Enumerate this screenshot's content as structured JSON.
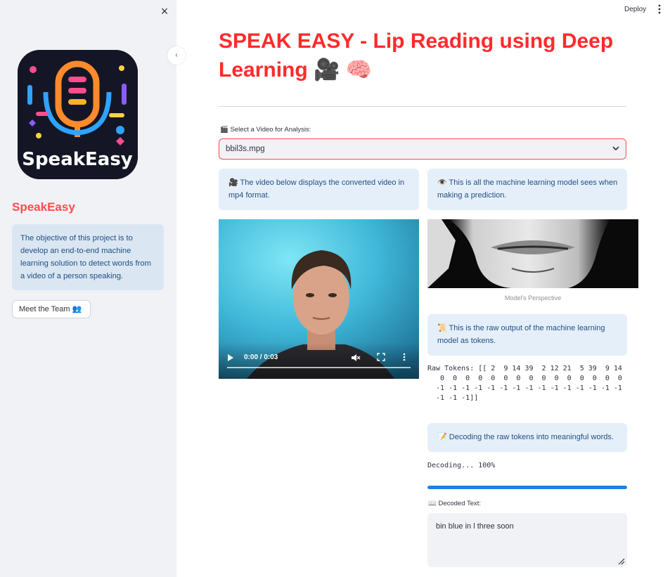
{
  "sidebar": {
    "close_glyph": "×",
    "logo_text": "SpeakEasy",
    "title": "SpeakEasy",
    "info": "The objective of this project is to develop an end-to-end machine learning solution to detect words from a video of a person speaking.",
    "team_button": "Meet the Team 👥",
    "collapse_glyph": "‹"
  },
  "header": {
    "deploy_label": "Deploy",
    "menu_glyph": "⋮"
  },
  "main": {
    "title": "SPEAK EASY - Lip Reading using Deep Learning 🎥 🧠",
    "select_label": "🎬 Select a Video for Analysis:",
    "select_value": "bbil3s.mpg",
    "video_info": "🎥 The video below displays the converted video in mp4 format.",
    "model_info": "👁️ This is all the machine learning model sees when making a prediction.",
    "video": {
      "time": "0:00 / 0:03",
      "progress": 0
    },
    "perspective_caption": "Model's Perspective",
    "tokens_info": "📜 This is the raw output of the machine learning model as tokens.",
    "raw_tokens": "Raw Tokens: [[ 2  9 14 39  2 12 21  5 39  9 14\n   0  0  0  0  0  0  0  0  0  0  0  0  0  0  0\n  -1 -1 -1 -1 -1 -1 -1 -1 -1 -1 -1 -1 -1 -1 -1\n  -1 -1 -1]]",
    "decode_info": "📝 Decoding the raw tokens into meaningful words.",
    "decoding_status": "Decoding... 100%",
    "decoding_progress": 1.0,
    "decoded_label": "📖 Decoded Text:",
    "decoded_text": "bin blue in l three soon"
  },
  "colors": {
    "accent": "#ff4b4b",
    "info_bg": "#e5effa",
    "info_text": "#1f4f82",
    "progress": "#1c83e1"
  },
  "icons": [
    "close-icon",
    "kebab-menu-icon",
    "chevron-down-icon",
    "play-icon",
    "mute-icon",
    "fullscreen-icon",
    "more-icon",
    "resize-handle-icon"
  ]
}
